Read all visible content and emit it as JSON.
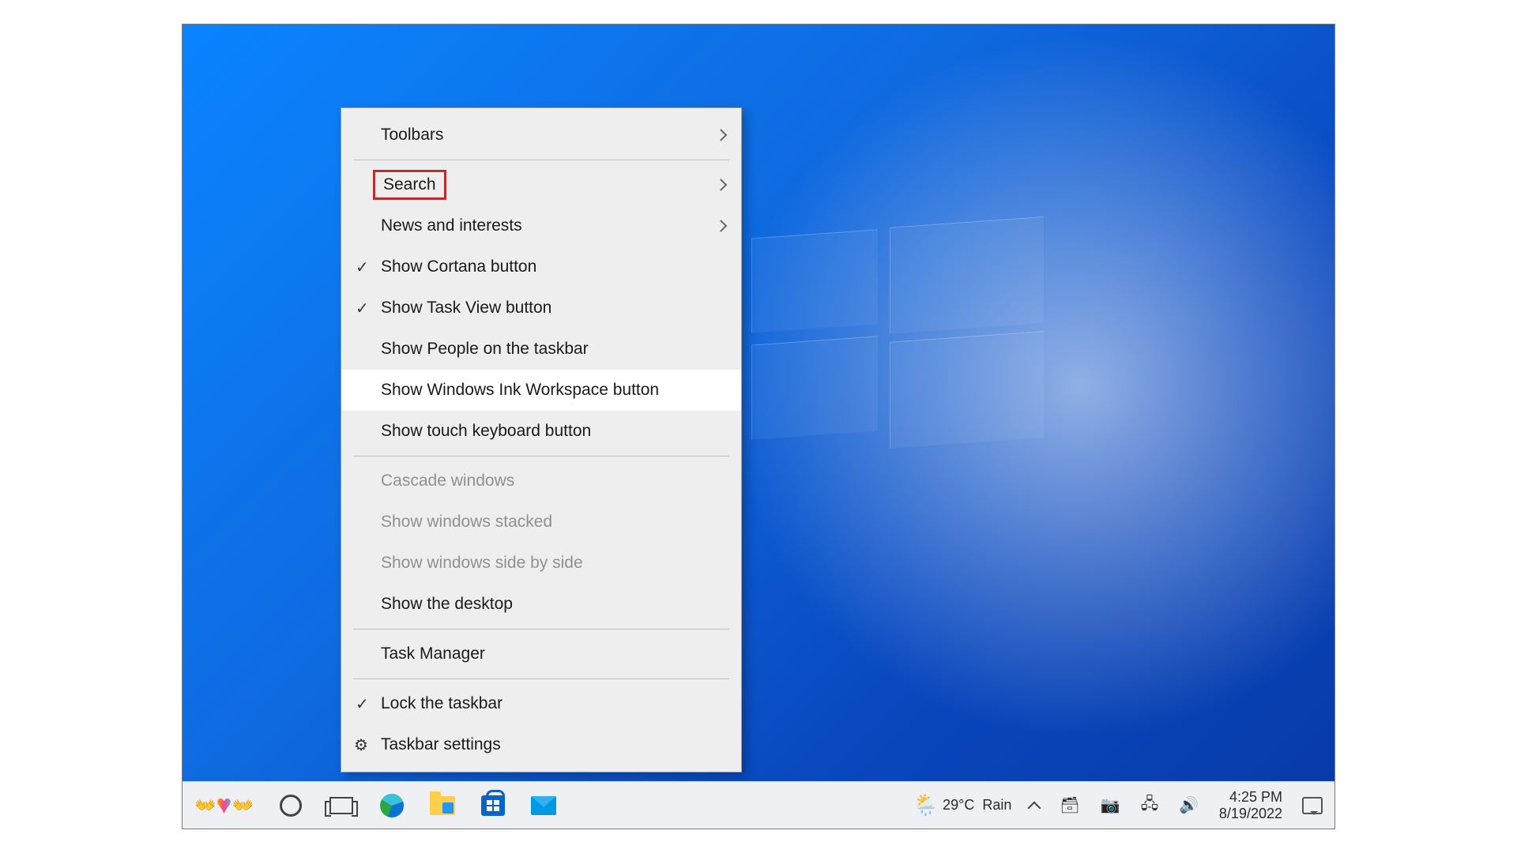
{
  "menu": {
    "items": [
      {
        "label": "Toolbars",
        "submenu": true
      },
      {
        "label": "Search",
        "submenu": true,
        "highlighted": true
      },
      {
        "label": "News and interests",
        "submenu": true
      },
      {
        "label": "Show Cortana button",
        "checked": true
      },
      {
        "label": "Show Task View button",
        "checked": true
      },
      {
        "label": "Show People on the taskbar"
      },
      {
        "label": "Show Windows Ink Workspace button",
        "hover": true
      },
      {
        "label": "Show touch keyboard button"
      }
    ],
    "items2": [
      {
        "label": "Cascade windows",
        "disabled": true
      },
      {
        "label": "Show windows stacked",
        "disabled": true
      },
      {
        "label": "Show windows side by side",
        "disabled": true
      },
      {
        "label": "Show the desktop"
      }
    ],
    "items3": [
      {
        "label": "Task Manager"
      }
    ],
    "items4": [
      {
        "label": "Lock the taskbar",
        "checked": true
      },
      {
        "label": "Taskbar settings",
        "gear": true
      }
    ]
  },
  "weather": {
    "temp": "29°C",
    "cond": "Rain"
  },
  "clock": {
    "time": "4:25 PM",
    "date": "8/19/2022"
  },
  "taskbar_apps": [
    "cortana",
    "task-view",
    "edge",
    "file-explorer",
    "microsoft-store",
    "mail"
  ],
  "tray_icons": [
    "show-hidden",
    "onedrive",
    "meet-now",
    "network",
    "volume"
  ]
}
